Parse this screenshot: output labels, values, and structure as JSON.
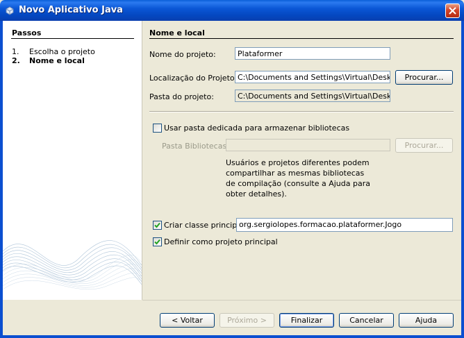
{
  "window": {
    "title": "Novo Aplicativo Java",
    "colors": {
      "titlebar": "#0b57d6",
      "close": "#d2452b",
      "dialog_bg": "#ece9d8"
    }
  },
  "steps": {
    "title": "Passos",
    "items": [
      {
        "number": "1.",
        "label": "Escolha o projeto",
        "current": false
      },
      {
        "number": "2.",
        "label": "Nome e local",
        "current": true
      }
    ]
  },
  "section": {
    "title": "Nome e local"
  },
  "form": {
    "project_name_label": "Nome do projeto:",
    "project_name_value": "Plataformer",
    "location_label": "Localização do Projeto:",
    "location_value": "C:\\Documents and Settings\\Virtual\\Desktop",
    "browse_label": "Procurar...",
    "folder_label": "Pasta do projeto:",
    "folder_value": "C:\\Documents and Settings\\Virtual\\Desktop\\Plataformer",
    "dedicated_folder_label": "Usar pasta dedicada para armazenar bibliotecas",
    "dedicated_folder_checked": false,
    "libraries_label": "Pasta Bibliotecas:",
    "libraries_value": "",
    "libraries_browse_label": "Procurar...",
    "help_text": "Usuários e projetos diferentes podem compartilhar as mesmas bibliotecas de compilação (consulte a Ajuda para obter detalhes).",
    "create_main_class_label": "Criar classe principal",
    "create_main_class_checked": true,
    "main_class_value": "org.sergiolopes.formacao.plataformer.Jogo",
    "set_main_project_label": "Definir como projeto principal",
    "set_main_project_checked": true
  },
  "buttons": {
    "back": "< Voltar",
    "next": "Próximo >",
    "finish": "Finalizar",
    "cancel": "Cancelar",
    "help": "Ajuda"
  },
  "icons": {
    "window_icon": "java-cup-icon",
    "close": "close-icon",
    "checkbox_mark": "checkmark-icon"
  }
}
